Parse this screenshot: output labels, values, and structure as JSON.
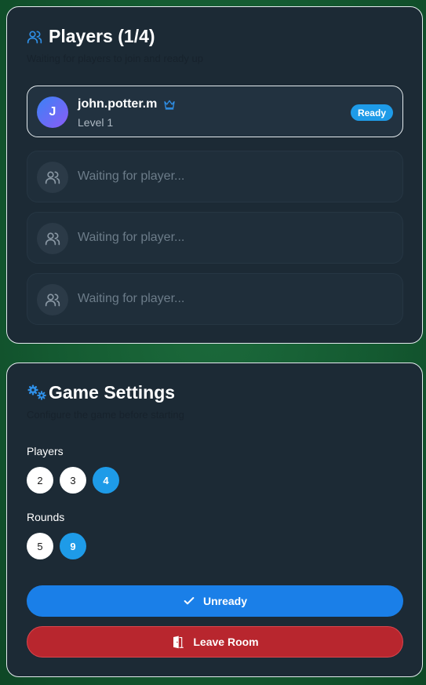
{
  "players_panel": {
    "title": "Players (1/4)",
    "subtitle": "Waiting for players to join and ready up",
    "host": {
      "initial": "J",
      "name": "john.potter.m",
      "level": "Level 1",
      "status": "Ready",
      "is_host_icon": "crown-icon"
    },
    "empty_slots": [
      {
        "text": "Waiting for player..."
      },
      {
        "text": "Waiting for player..."
      },
      {
        "text": "Waiting for player..."
      }
    ]
  },
  "settings_panel": {
    "title": "Game Settings",
    "subtitle": "Configure the game before starting",
    "players": {
      "label": "Players",
      "options": [
        "2",
        "3",
        "4"
      ],
      "selected": "4"
    },
    "rounds": {
      "label": "Rounds",
      "options": [
        "5",
        "9"
      ],
      "selected": "9"
    },
    "unready_label": "Unready",
    "leave_label": "Leave Room"
  },
  "colors": {
    "accent": "#1e9be8",
    "primary_button": "#1a7fe8",
    "danger_button": "#b8262e",
    "card_bg": "#1c2a35"
  }
}
